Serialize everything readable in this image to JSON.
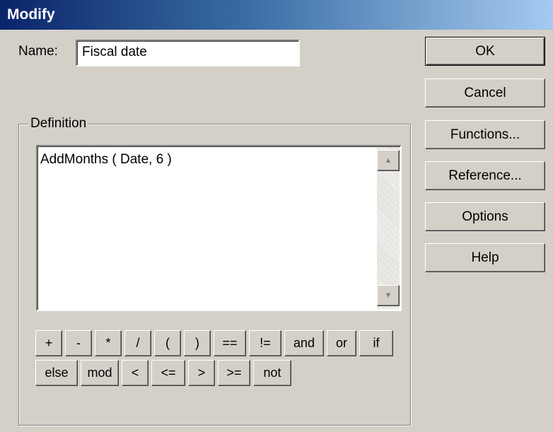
{
  "window": {
    "title": "Modify"
  },
  "name_field": {
    "label": "Name:",
    "value": "Fiscal date"
  },
  "definition": {
    "legend": "Definition",
    "text": "AddMonths ( Date, 6 )"
  },
  "buttons": {
    "ok": "OK",
    "cancel": "Cancel",
    "functions": "Functions...",
    "reference": "Reference...",
    "options": "Options",
    "help": "Help"
  },
  "operators_row1": [
    "+",
    "-",
    "*",
    "/",
    "(",
    ")",
    "==",
    "!=",
    "and",
    "or",
    "if"
  ],
  "operators_row2": [
    "else",
    "mod",
    "<",
    "<=",
    ">",
    ">=",
    "not"
  ],
  "icons": {
    "scroll_up": "scroll-up-arrow-icon",
    "scroll_down": "scroll-down-arrow-icon"
  }
}
